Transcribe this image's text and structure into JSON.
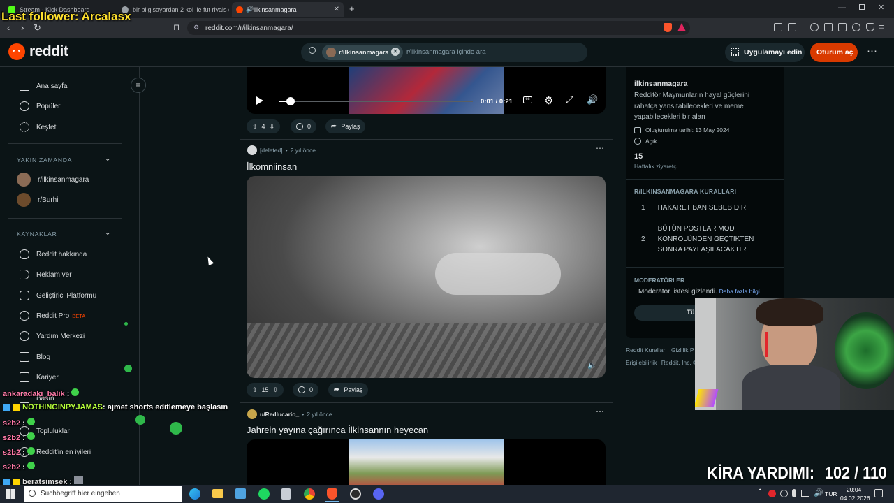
{
  "overlay": {
    "last_follower": "Last follower: Arcalasx",
    "rent_help": "KİRA YARDIMI:",
    "rent_count": "102 / 110"
  },
  "browser": {
    "tabs": [
      {
        "label": "Stream - Kick Dashboard"
      },
      {
        "label": "bir bilgisayardan 2 kol ile fut rivals oy"
      },
      {
        "label": "ilkinsanmagara",
        "active": true
      }
    ],
    "url": "reddit.com/r/ilkinsanmagara/"
  },
  "header": {
    "logo": "reddit",
    "search_chip": "r/ilkinsanmagara",
    "search_placeholder": "r/ilkinsanmagara içinde ara",
    "app_button": "Uygulamayı edin",
    "login_button": "Oturum aç"
  },
  "sidebar": {
    "main": [
      {
        "label": "Ana sayfa",
        "icon": "home-icon"
      },
      {
        "label": "Popüler",
        "icon": "popular-icon"
      },
      {
        "label": "Keşfet",
        "icon": "explore-icon"
      }
    ],
    "recent_heading": "YAKIN ZAMANDA",
    "recent": [
      {
        "label": "r/ilkinsanmagara"
      },
      {
        "label": "r/Burhi"
      }
    ],
    "resources_heading": "KAYNAKLAR",
    "resources": [
      {
        "label": "Reddit hakkında",
        "icon": "reddit-about-icon"
      },
      {
        "label": "Reklam ver",
        "icon": "advertise-icon"
      },
      {
        "label": "Geliştirici Platformu",
        "icon": "developer-icon"
      },
      {
        "label": "Reddit Pro",
        "icon": "pro-icon",
        "badge": "BETA"
      },
      {
        "label": "Yardım Merkezi",
        "icon": "help-icon"
      },
      {
        "label": "Blog",
        "icon": "blog-icon"
      },
      {
        "label": "Kariyer",
        "icon": "careers-icon"
      },
      {
        "label": "Basın",
        "icon": "press-icon"
      },
      {
        "label": "Topluluklar",
        "icon": "communities-icon"
      },
      {
        "label": "Reddit'in en iyileri",
        "icon": "best-of-icon"
      }
    ]
  },
  "video_player": {
    "time": "0:01 / 0:21",
    "progress": 0.05
  },
  "posts": [
    {
      "upvotes": "4",
      "comments": "0",
      "share": "Paylaş"
    },
    {
      "author": "[deleted]",
      "age": "2 yıl önce",
      "title": "İlkomniinsan",
      "upvotes": "15",
      "comments": "0",
      "share": "Paylaş"
    },
    {
      "author": "u/Redlucario_",
      "age": "2 yıl önce",
      "title": "Jahrein yayına çağırınca İlkinsannın heyecan"
    }
  ],
  "about": {
    "name": "ilkinsanmagara",
    "description": "Redditör Maymunların hayal güçlerini rahatça yansıtabilecekleri ve meme yapabilecekleri bir alan",
    "created": "Oluşturulma tarihi: 13 May 2024",
    "visibility": "Açık",
    "weekly_visitors": "15",
    "weekly_visitors_label": "Haftalık ziyaretçi",
    "rules_heading": "R/İLKİNSANMAGARA KURALLARI",
    "rules": [
      {
        "num": "1",
        "text": "HAKARET BAN SEBEBİDİR"
      },
      {
        "num": "2",
        "text": "BÜTÜN POSTLAR MOD KONROLÜNDEN GEÇTİKTEN SONRA PAYLAŞILACAKTIR"
      }
    ],
    "mods_heading": "MODERATÖRLER",
    "mods_hidden": "Moderatör listesi gizlendi.",
    "mods_more": "Daha fazla bilgi",
    "all_mods_button": "Tüm moder",
    "footer": [
      "Reddit Kuralları",
      "Gizlilik P",
      "Erişilebilirlik",
      "Reddit, Inc. ©"
    ]
  },
  "chat": [
    {
      "user": "ankaradaki_balik",
      "message": "",
      "color": "#ff7aa8"
    },
    {
      "user": "NOTHINGINPYJAMAS",
      "message": ": ajmet shorts editlemeye başlasın",
      "color": "#b6ff3a"
    },
    {
      "user": "s2b2",
      "message": "",
      "color": "#ff7aa8"
    },
    {
      "user": "s2b2",
      "message": "",
      "color": "#ff7aa8"
    },
    {
      "user": "s2b2",
      "message": "",
      "color": "#ff7aa8"
    },
    {
      "user": "s2b2",
      "message": "",
      "color": "#ff7aa8"
    },
    {
      "user": "beratsimsek",
      "message": "",
      "color": "#e0e0e0"
    }
  ],
  "taskbar": {
    "search_placeholder": "Suchbegriff hier eingeben",
    "lang": "TUR",
    "time": "20:04",
    "date": "04.02.2026"
  }
}
